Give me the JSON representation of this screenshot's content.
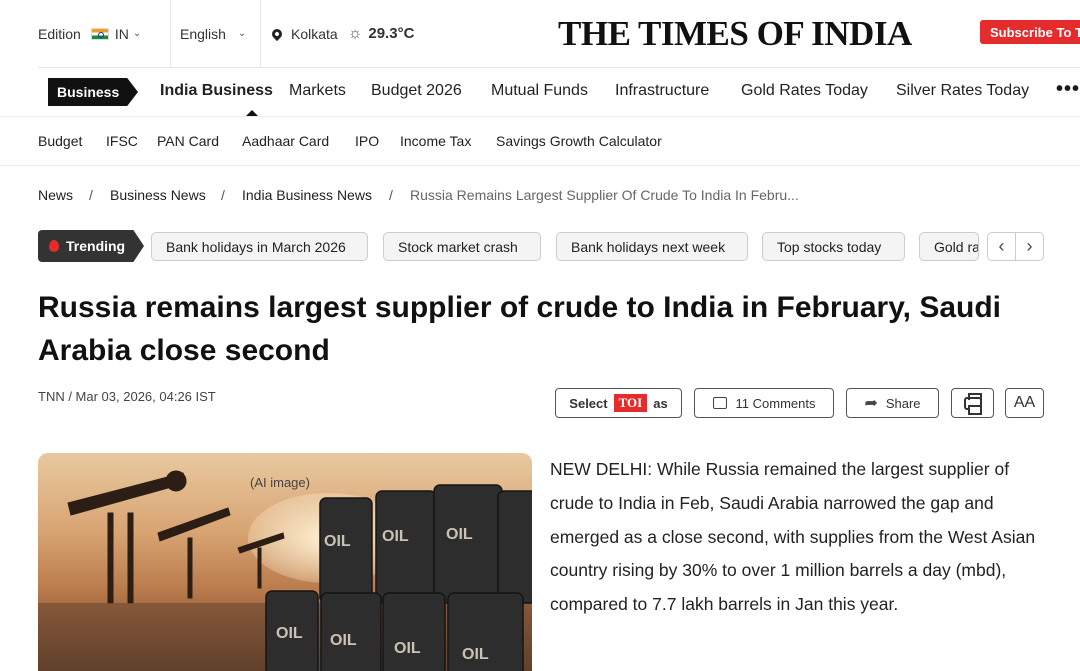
{
  "topbar": {
    "edition_label": "Edition",
    "edition_value": "IN",
    "language": "English",
    "city": "Kolkata",
    "temperature": "29.3°C",
    "logo": "THE TIMES OF INDIA",
    "subscribe": "Subscribe To TOI+"
  },
  "nav": {
    "section": "Business",
    "items": [
      "India Business",
      "Markets",
      "Budget 2026",
      "Mutual Funds",
      "Infrastructure",
      "Gold Rates Today",
      "Silver Rates Today"
    ],
    "more": "•••"
  },
  "subnav": {
    "items": [
      "Budget",
      "IFSC",
      "PAN Card",
      "Aadhaar Card",
      "IPO",
      "Income Tax",
      "Savings Growth Calculator"
    ]
  },
  "breadcrumb": {
    "items": [
      "News",
      "Business News",
      "India Business News",
      "Russia Remains Largest Supplier Of Crude To India In Febru..."
    ],
    "separator": "/"
  },
  "trending": {
    "label": "Trending",
    "items": [
      "Bank holidays in March 2026",
      "Stock market crash",
      "Bank holidays next week",
      "Top stocks today",
      "Gold rate today"
    ],
    "prev": "‹",
    "next": "›"
  },
  "article": {
    "headline": "Russia remains largest supplier of crude to India in February, Saudi Arabia close second",
    "byline": "TNN / Mar 03, 2026, 04:26 IST",
    "image_caption": "(AI image)",
    "body": "NEW DELHI: While Russia remained the largest supplier of crude to India in Feb, Saudi Arabia narrowed the gap and emerged as a close second, with supplies from the West Asian country rising by 30% to over 1 million barrels a day (mbd), compared to 7.7 lakh barrels in Jan this year."
  },
  "tools": {
    "select_prefix": "Select",
    "select_badge": "TOI",
    "select_suffix": "as",
    "comments": "11 Comments",
    "share": "Share",
    "font_size": "AA"
  },
  "colors": {
    "accent": "#e52c2c",
    "dark": "#111111"
  }
}
